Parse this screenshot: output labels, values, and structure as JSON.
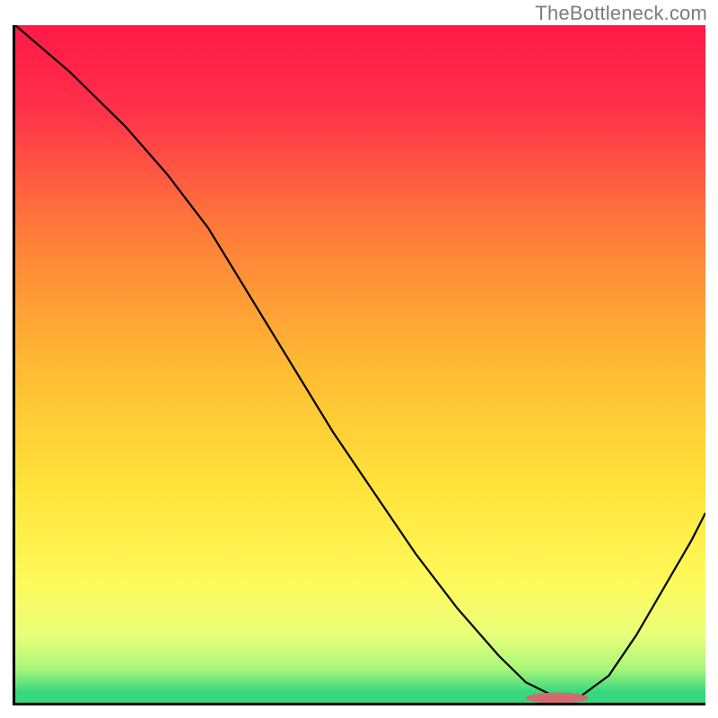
{
  "watermark": "TheBottleneck.com",
  "chart_data": {
    "type": "line",
    "title": "",
    "xlabel": "",
    "ylabel": "",
    "xlim": [
      0,
      100
    ],
    "ylim": [
      0,
      100
    ],
    "grid": false,
    "legend": false,
    "series": [
      {
        "name": "bottleneck-curve",
        "x": [
          0,
          8,
          16,
          22,
          28,
          34,
          40,
          46,
          52,
          58,
          64,
          70,
          74,
          78,
          82,
          86,
          90,
          94,
          98,
          100
        ],
        "values": [
          100,
          93,
          85,
          78,
          70,
          60,
          50,
          40,
          31,
          22,
          14,
          7,
          3,
          1,
          1,
          4,
          10,
          17,
          24,
          28
        ]
      }
    ],
    "marker": {
      "name": "optimal-range",
      "x_start": 74,
      "x_end": 83,
      "y": 0.7,
      "color": "#d36a6e"
    },
    "background_gradient": {
      "stops": [
        {
          "offset": 0.0,
          "color": "#ff1a46"
        },
        {
          "offset": 0.12,
          "color": "#ff2f4a"
        },
        {
          "offset": 0.3,
          "color": "#ff7a3a"
        },
        {
          "offset": 0.5,
          "color": "#ffb933"
        },
        {
          "offset": 0.68,
          "color": "#ffe33a"
        },
        {
          "offset": 0.82,
          "color": "#fff95a"
        },
        {
          "offset": 0.9,
          "color": "#e8ff7a"
        },
        {
          "offset": 0.95,
          "color": "#a8f77a"
        },
        {
          "offset": 0.985,
          "color": "#36d77e"
        },
        {
          "offset": 1.0,
          "color": "#36d77e"
        }
      ]
    }
  }
}
